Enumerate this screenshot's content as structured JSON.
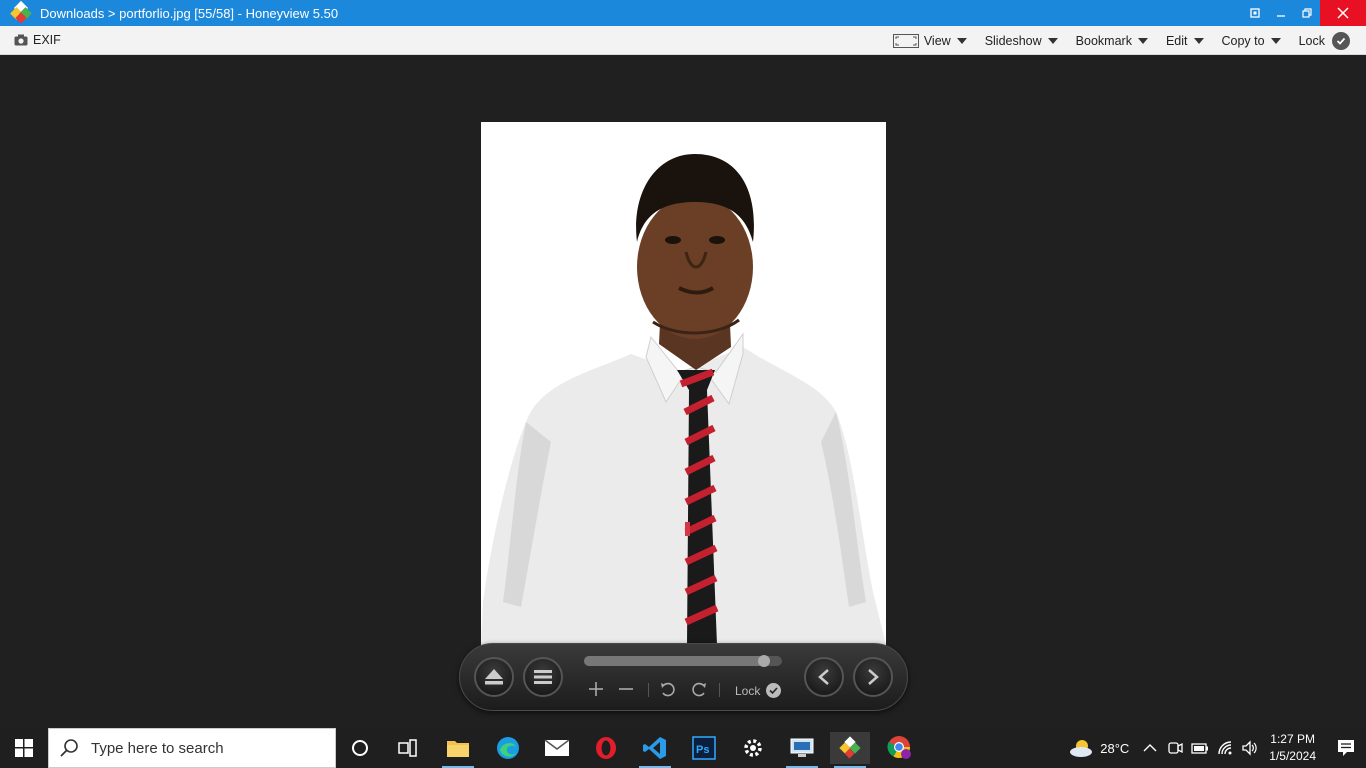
{
  "titlebar": {
    "title": "Downloads > portforlio.jpg [55/58] - Honeyview 5.50"
  },
  "toolbar": {
    "exif_label": "EXIF",
    "menus": [
      {
        "label": "View"
      },
      {
        "label": "Slideshow"
      },
      {
        "label": "Bookmark"
      },
      {
        "label": "Edit"
      },
      {
        "label": "Copy to"
      },
      {
        "label": "Lock"
      }
    ]
  },
  "viewer": {
    "image_alt": "portrait photo",
    "controlbar": {
      "slider_position": 0.91,
      "lock_label": "Lock"
    }
  },
  "taskbar": {
    "search_placeholder": "Type here to search",
    "apps": [
      "task-view",
      "file-explorer",
      "edge",
      "mail",
      "opera",
      "vscode",
      "photoshop",
      "settings",
      "remote-desktop",
      "honeyview",
      "chrome"
    ],
    "weather": "28°C",
    "time": "1:27 PM",
    "date": "1/5/2024"
  },
  "colors": {
    "titlebar": "#1c88dc",
    "close": "#e81123",
    "viewer_bg": "#202020",
    "taskbar": "#1f1f1f"
  }
}
